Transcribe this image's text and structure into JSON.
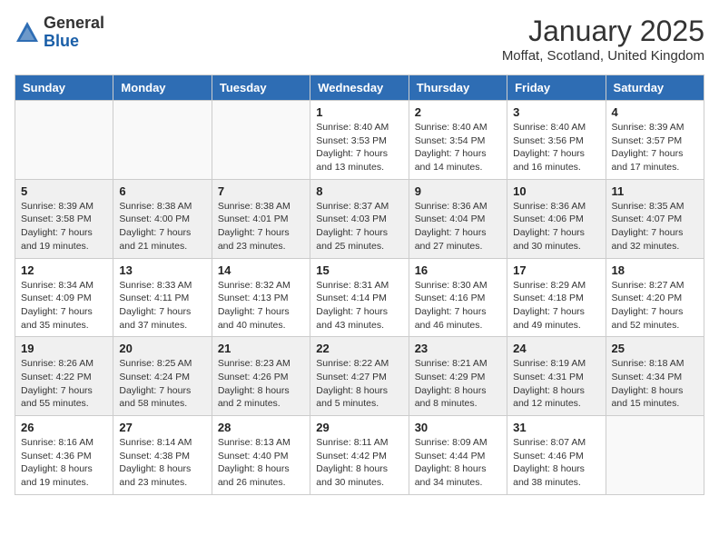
{
  "logo": {
    "general": "General",
    "blue": "Blue"
  },
  "header": {
    "month_year": "January 2025",
    "location": "Moffat, Scotland, United Kingdom"
  },
  "days_of_week": [
    "Sunday",
    "Monday",
    "Tuesday",
    "Wednesday",
    "Thursday",
    "Friday",
    "Saturday"
  ],
  "weeks": [
    [
      {
        "day": "",
        "info": ""
      },
      {
        "day": "",
        "info": ""
      },
      {
        "day": "",
        "info": ""
      },
      {
        "day": "1",
        "info": "Sunrise: 8:40 AM\nSunset: 3:53 PM\nDaylight: 7 hours\nand 13 minutes."
      },
      {
        "day": "2",
        "info": "Sunrise: 8:40 AM\nSunset: 3:54 PM\nDaylight: 7 hours\nand 14 minutes."
      },
      {
        "day": "3",
        "info": "Sunrise: 8:40 AM\nSunset: 3:56 PM\nDaylight: 7 hours\nand 16 minutes."
      },
      {
        "day": "4",
        "info": "Sunrise: 8:39 AM\nSunset: 3:57 PM\nDaylight: 7 hours\nand 17 minutes."
      }
    ],
    [
      {
        "day": "5",
        "info": "Sunrise: 8:39 AM\nSunset: 3:58 PM\nDaylight: 7 hours\nand 19 minutes."
      },
      {
        "day": "6",
        "info": "Sunrise: 8:38 AM\nSunset: 4:00 PM\nDaylight: 7 hours\nand 21 minutes."
      },
      {
        "day": "7",
        "info": "Sunrise: 8:38 AM\nSunset: 4:01 PM\nDaylight: 7 hours\nand 23 minutes."
      },
      {
        "day": "8",
        "info": "Sunrise: 8:37 AM\nSunset: 4:03 PM\nDaylight: 7 hours\nand 25 minutes."
      },
      {
        "day": "9",
        "info": "Sunrise: 8:36 AM\nSunset: 4:04 PM\nDaylight: 7 hours\nand 27 minutes."
      },
      {
        "day": "10",
        "info": "Sunrise: 8:36 AM\nSunset: 4:06 PM\nDaylight: 7 hours\nand 30 minutes."
      },
      {
        "day": "11",
        "info": "Sunrise: 8:35 AM\nSunset: 4:07 PM\nDaylight: 7 hours\nand 32 minutes."
      }
    ],
    [
      {
        "day": "12",
        "info": "Sunrise: 8:34 AM\nSunset: 4:09 PM\nDaylight: 7 hours\nand 35 minutes."
      },
      {
        "day": "13",
        "info": "Sunrise: 8:33 AM\nSunset: 4:11 PM\nDaylight: 7 hours\nand 37 minutes."
      },
      {
        "day": "14",
        "info": "Sunrise: 8:32 AM\nSunset: 4:13 PM\nDaylight: 7 hours\nand 40 minutes."
      },
      {
        "day": "15",
        "info": "Sunrise: 8:31 AM\nSunset: 4:14 PM\nDaylight: 7 hours\nand 43 minutes."
      },
      {
        "day": "16",
        "info": "Sunrise: 8:30 AM\nSunset: 4:16 PM\nDaylight: 7 hours\nand 46 minutes."
      },
      {
        "day": "17",
        "info": "Sunrise: 8:29 AM\nSunset: 4:18 PM\nDaylight: 7 hours\nand 49 minutes."
      },
      {
        "day": "18",
        "info": "Sunrise: 8:27 AM\nSunset: 4:20 PM\nDaylight: 7 hours\nand 52 minutes."
      }
    ],
    [
      {
        "day": "19",
        "info": "Sunrise: 8:26 AM\nSunset: 4:22 PM\nDaylight: 7 hours\nand 55 minutes."
      },
      {
        "day": "20",
        "info": "Sunrise: 8:25 AM\nSunset: 4:24 PM\nDaylight: 7 hours\nand 58 minutes."
      },
      {
        "day": "21",
        "info": "Sunrise: 8:23 AM\nSunset: 4:26 PM\nDaylight: 8 hours\nand 2 minutes."
      },
      {
        "day": "22",
        "info": "Sunrise: 8:22 AM\nSunset: 4:27 PM\nDaylight: 8 hours\nand 5 minutes."
      },
      {
        "day": "23",
        "info": "Sunrise: 8:21 AM\nSunset: 4:29 PM\nDaylight: 8 hours\nand 8 minutes."
      },
      {
        "day": "24",
        "info": "Sunrise: 8:19 AM\nSunset: 4:31 PM\nDaylight: 8 hours\nand 12 minutes."
      },
      {
        "day": "25",
        "info": "Sunrise: 8:18 AM\nSunset: 4:34 PM\nDaylight: 8 hours\nand 15 minutes."
      }
    ],
    [
      {
        "day": "26",
        "info": "Sunrise: 8:16 AM\nSunset: 4:36 PM\nDaylight: 8 hours\nand 19 minutes."
      },
      {
        "day": "27",
        "info": "Sunrise: 8:14 AM\nSunset: 4:38 PM\nDaylight: 8 hours\nand 23 minutes."
      },
      {
        "day": "28",
        "info": "Sunrise: 8:13 AM\nSunset: 4:40 PM\nDaylight: 8 hours\nand 26 minutes."
      },
      {
        "day": "29",
        "info": "Sunrise: 8:11 AM\nSunset: 4:42 PM\nDaylight: 8 hours\nand 30 minutes."
      },
      {
        "day": "30",
        "info": "Sunrise: 8:09 AM\nSunset: 4:44 PM\nDaylight: 8 hours\nand 34 minutes."
      },
      {
        "day": "31",
        "info": "Sunrise: 8:07 AM\nSunset: 4:46 PM\nDaylight: 8 hours\nand 38 minutes."
      },
      {
        "day": "",
        "info": ""
      }
    ]
  ]
}
